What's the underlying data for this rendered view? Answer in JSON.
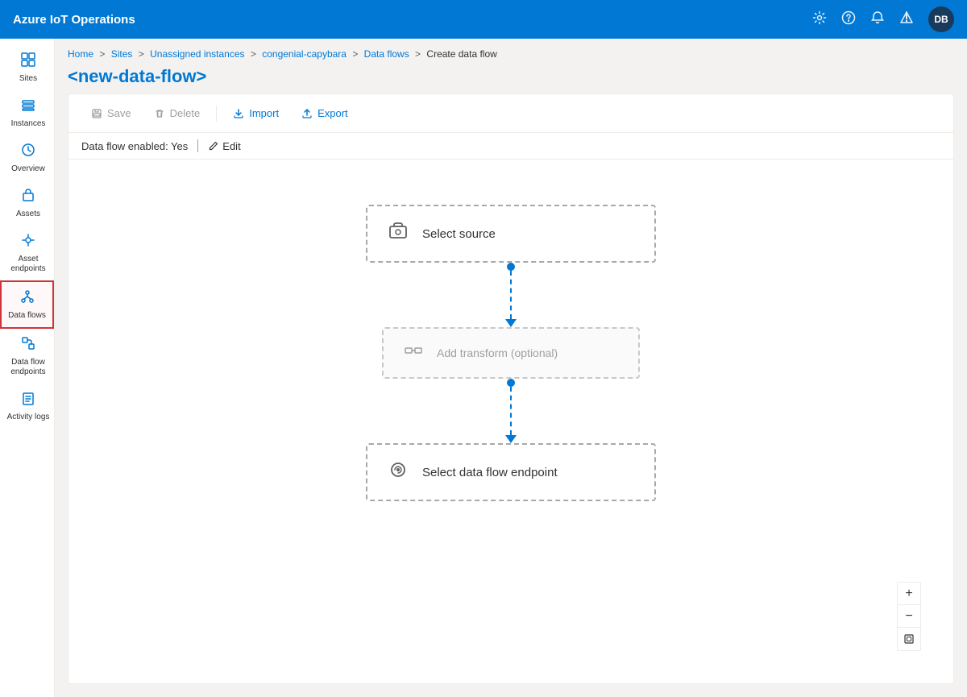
{
  "app": {
    "title": "Azure IoT Operations"
  },
  "topbar": {
    "title": "Azure IoT Operations",
    "icons": [
      "settings",
      "help",
      "bell",
      "notifications"
    ],
    "avatar": "DB"
  },
  "breadcrumb": {
    "items": [
      "Home",
      "Sites",
      "Unassigned instances",
      "congenial-capybara",
      "Data flows",
      "Create data flow"
    ]
  },
  "page": {
    "title": "<new-data-flow>"
  },
  "toolbar": {
    "save_label": "Save",
    "delete_label": "Delete",
    "import_label": "Import",
    "export_label": "Export"
  },
  "status": {
    "text": "Data flow enabled: Yes",
    "edit_label": "Edit"
  },
  "sidebar": {
    "items": [
      {
        "label": "Sites",
        "icon": "grid"
      },
      {
        "label": "Instances",
        "icon": "stack"
      },
      {
        "label": "Overview",
        "icon": "eye"
      },
      {
        "label": "Assets",
        "icon": "box"
      },
      {
        "label": "Asset endpoints",
        "icon": "endpoint"
      },
      {
        "label": "Data flows",
        "icon": "dataflow",
        "active": true
      },
      {
        "label": "Data flow endpoints",
        "icon": "flowend"
      },
      {
        "label": "Activity logs",
        "icon": "log"
      }
    ]
  },
  "flow": {
    "source_label": "Select source",
    "transform_label": "Add transform (optional)",
    "destination_label": "Select data flow endpoint"
  },
  "zoom": {
    "plus": "+",
    "minus": "−",
    "reset": "⊡"
  }
}
